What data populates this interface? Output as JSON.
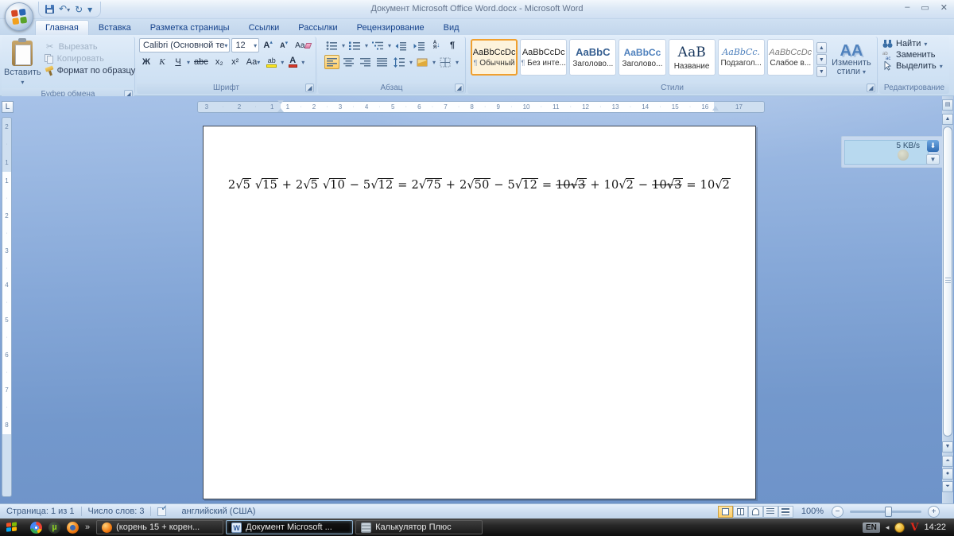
{
  "window": {
    "title": "Документ Microsoft Office Word.docx - Microsoft Word",
    "controls": {
      "minimize": "–",
      "restore": "▭",
      "close": "✕"
    }
  },
  "quick_access": {
    "undo": "↶",
    "redo": "↻",
    "more": "▾"
  },
  "ribbon": {
    "tabs": [
      {
        "label": "Главная"
      },
      {
        "label": "Вставка"
      },
      {
        "label": "Разметка страницы"
      },
      {
        "label": "Ссылки"
      },
      {
        "label": "Рассылки"
      },
      {
        "label": "Рецензирование"
      },
      {
        "label": "Вид"
      }
    ],
    "clipboard": {
      "label": "Буфер обмена",
      "paste": "Вставить",
      "cut": "Вырезать",
      "copy": "Копировать",
      "format_painter": "Формат по образцу"
    },
    "font": {
      "label": "Шрифт",
      "font_name": "Calibri (Основной те",
      "font_size": "12",
      "bold": "Ж",
      "italic": "К",
      "underline": "Ч",
      "strikethrough": "abc",
      "subscript": "x₂",
      "superscript": "x²",
      "change_case": "Aa",
      "grow": "А",
      "shrink": "А",
      "clear": "Аа",
      "highlight": "ab",
      "font_color": "А"
    },
    "paragraph": {
      "label": "Абзац",
      "sort_letters_top": "А",
      "sort_letters_bottom": "Я",
      "sort_arrow": "↓",
      "pilcrow": "¶"
    },
    "styles": {
      "label": "Стили",
      "change_styles": "Изменить стили",
      "aa_icon": "АА",
      "pilcrow": "¶",
      "items": [
        {
          "sample": "AaBbCcDc",
          "label": "Обычный",
          "cls": "s-normal",
          "sel": "sel",
          "pilcrow": "¶"
        },
        {
          "sample": "AaBbCcDc",
          "label": "Без инте...",
          "cls": "s-normal",
          "sel": "",
          "pilcrow": "¶"
        },
        {
          "sample": "AaBbC",
          "label": "Заголово...",
          "cls": "s-h1",
          "sel": "",
          "pilcrow": ""
        },
        {
          "sample": "AaBbCc",
          "label": "Заголово...",
          "cls": "s-h2",
          "sel": "",
          "pilcrow": ""
        },
        {
          "sample": "АаВ",
          "label": "Название",
          "cls": "s-title",
          "sel": "",
          "pilcrow": ""
        },
        {
          "sample": "AaBbCc.",
          "label": "Подзагол...",
          "cls": "s-sub",
          "sel": "",
          "pilcrow": ""
        },
        {
          "sample": "AaBbCcDc",
          "label": "Слабое в...",
          "cls": "s-weak",
          "sel": "",
          "pilcrow": ""
        }
      ]
    },
    "editing": {
      "label": "Редактирование",
      "find": "Найти",
      "replace": "Заменить",
      "select": "Выделить"
    }
  },
  "ruler": {
    "tab_selector": "L",
    "h_left": [
      "3",
      "2",
      "1"
    ],
    "h_main": [
      "1",
      "2",
      "3",
      "4",
      "5",
      "6",
      "7",
      "8",
      "9",
      "10",
      "11",
      "12",
      "13",
      "14",
      "15",
      "16"
    ],
    "h_right": [
      "17"
    ],
    "v_top": [
      "2",
      "1"
    ],
    "v_main": [
      "1",
      "2",
      "3",
      "4",
      "5",
      "6",
      "7",
      "8"
    ]
  },
  "doc": {
    "formula": {
      "segments": [
        {
          "t": "2"
        },
        {
          "s": "5"
        },
        {
          "t": " "
        },
        {
          "s": "15"
        },
        {
          "t": " + 2"
        },
        {
          "s": "5"
        },
        {
          "t": " "
        },
        {
          "s": "10"
        },
        {
          "t": " − 5"
        },
        {
          "s": "12"
        },
        {
          "t": " = 2"
        },
        {
          "s": "75"
        },
        {
          "t": " + 2"
        },
        {
          "s": "50"
        },
        {
          "t": " − 5"
        },
        {
          "s": "12"
        },
        {
          "t": " = "
        },
        {
          "t": "10",
          "strike": true
        },
        {
          "s": "3",
          "strike": true
        },
        {
          "t": " + 10"
        },
        {
          "s": "2"
        },
        {
          "t": " − "
        },
        {
          "t": "10",
          "strike": true
        },
        {
          "s": "3",
          "strike": true
        },
        {
          "t": " = 10"
        },
        {
          "s": "2"
        }
      ]
    }
  },
  "overlay": {
    "speed": "5 KB/s",
    "download_arrow": "⬇",
    "caret": "▼"
  },
  "status_bar": {
    "page": "Страница: 1 из 1",
    "words": "Число слов: 3",
    "language": "английский (США)",
    "zoom": "100%",
    "zoom_out": "−",
    "zoom_in": "+"
  },
  "taskbar": {
    "quick_launch_more": "»",
    "utorrent_letter": "µ",
    "word_letter": "W",
    "tasks": [
      {
        "label": "(корень 15 + корен..."
      },
      {
        "label": "Документ Microsoft ..."
      },
      {
        "label": "Калькулятор Плюс"
      }
    ],
    "tray": {
      "lang": "EN",
      "hidden_arrow": "◂",
      "time": "14:22"
    }
  },
  "colors": {
    "selection_orange": "#f0a02f",
    "heading_blue": "#365f91",
    "accent_blue": "#4f81bd",
    "backdrop_blue": "#7398cc"
  }
}
